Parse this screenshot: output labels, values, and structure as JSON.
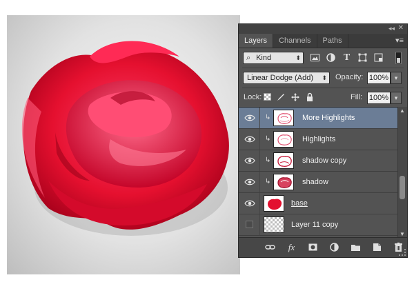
{
  "panel": {
    "window_controls": {
      "collapse_icon": "double-chevron-left-icon",
      "close_icon": "close-icon"
    },
    "tabs": [
      {
        "label": "Layers",
        "active": true
      },
      {
        "label": "Channels",
        "active": false
      },
      {
        "label": "Paths",
        "active": false
      }
    ],
    "filter": {
      "kind_label": "Kind",
      "icons": [
        "image-filter-icon",
        "adjustment-filter-icon",
        "type-filter-icon",
        "shape-filter-icon",
        "smart-object-filter-icon"
      ]
    },
    "blend": {
      "mode": "Linear Dodge (Add)",
      "opacity_label": "Opacity:",
      "opacity_value": "100%"
    },
    "lock": {
      "label": "Lock:",
      "fill_label": "Fill:",
      "fill_value": "100%",
      "icons": [
        "lock-transparent-pixels-icon",
        "lock-image-pixels-icon",
        "lock-position-icon",
        "lock-all-icon"
      ]
    },
    "layers": [
      {
        "name": "More Highlights",
        "visible": true,
        "clipped": true,
        "selected": true,
        "thumb": "rose-sketch"
      },
      {
        "name": "Highlights",
        "visible": true,
        "clipped": true,
        "selected": false,
        "thumb": "rose-sketch"
      },
      {
        "name": "shadow copy",
        "visible": true,
        "clipped": true,
        "selected": false,
        "thumb": "rose-sketch"
      },
      {
        "name": "shadow",
        "visible": true,
        "clipped": true,
        "selected": false,
        "thumb": "rose-dark"
      },
      {
        "name": "base",
        "visible": true,
        "clipped": false,
        "selected": false,
        "thumb": "rose-solid"
      },
      {
        "name": "Layer 11 copy",
        "visible": false,
        "clipped": false,
        "selected": false,
        "thumb": "transparent"
      }
    ],
    "footer_icons": [
      "link-layers-icon",
      "layer-style-fx-icon",
      "add-mask-icon",
      "new-adjustment-layer-icon",
      "new-group-folder-icon",
      "new-layer-icon",
      "delete-layer-icon"
    ],
    "fx_label": "fx",
    "colors": {
      "panel_bg": "#535353",
      "selected_row": "#6b7d96",
      "rose_red": "#e8103a"
    }
  }
}
